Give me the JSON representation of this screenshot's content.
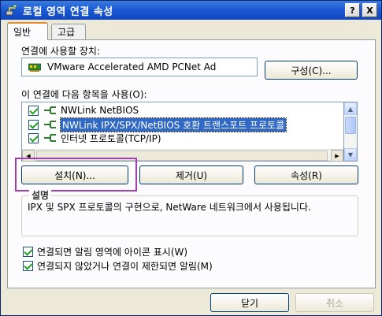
{
  "window": {
    "title": "로컬 영역 연결 속성",
    "help_button": "?",
    "close_button": "X"
  },
  "tabs": [
    {
      "label": "일반",
      "active": true
    },
    {
      "label": "고급",
      "active": false
    }
  ],
  "connect_using": {
    "label": "연결에 사용할 장치:",
    "device": "VMware Accelerated AMD PCNet Ad",
    "configure_button": "구성(C)..."
  },
  "items_section": {
    "label": "이 연결에 다음 항목을 사용(O):",
    "items": [
      {
        "label": "NWLink NetBIOS",
        "checked": true,
        "selected": false
      },
      {
        "label": "NWLink IPX/SPX/NetBIOS 호환 트랜스포트 프로토콜",
        "checked": true,
        "selected": true
      },
      {
        "label": "인터넷 프로토콜(TCP/IP)",
        "checked": true,
        "selected": false
      }
    ]
  },
  "buttons": {
    "install": "설치(N)...",
    "uninstall": "제거(U)",
    "properties": "속성(R)",
    "ok": "닫기",
    "cancel": "취소"
  },
  "description": {
    "legend": "설명",
    "text": "IPX 및 SPX 프로토콜의 구현으로, NetWare 네트워크에서 사용됩니다."
  },
  "options": {
    "show_icon": {
      "label": "연결되면 알림 영역에 아이콘 표시(W)",
      "checked": true
    },
    "notify_limited": {
      "label": "연결되지 않았거나 연결이 제한되면 알림(M)",
      "checked": true
    }
  },
  "colors": {
    "titlebar": "#1c5bd4",
    "selection": "#316ac5",
    "annotation_box": "#a040b0"
  }
}
